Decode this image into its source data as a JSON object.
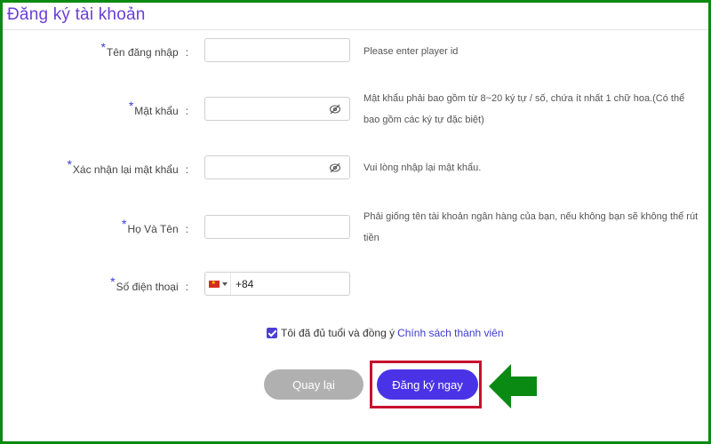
{
  "page": {
    "title": "Đăng ký tài khoản"
  },
  "form": {
    "required_mark": "*",
    "colon": ":",
    "username": {
      "label": "Tên đăng nhập",
      "value": "",
      "hint": "Please enter player id"
    },
    "password": {
      "label": "Mật khẩu",
      "value": "",
      "hint": "Mật khẩu phải bao gồm từ 8~20 ký tự / số, chứa ít nhất 1 chữ hoa.(Có thể bao gồm các ký tự đặc biệt)"
    },
    "confirm_password": {
      "label": "Xác nhận lại mật khẩu",
      "value": "",
      "hint": "Vui lòng nhập lại mật khẩu."
    },
    "full_name": {
      "label": "Họ Và Tên",
      "value": "",
      "hint": "Phải giống tên tài khoản ngân hàng của bạn, nếu không bạn sẽ không thể rút tiền"
    },
    "phone": {
      "label": "Số điện thoại",
      "country_code": "+84",
      "flag_icon": "vietnam-flag-icon"
    },
    "agree": {
      "text": "Tôi đã đủ tuổi và đồng ý",
      "link": "Chính sách thành viên",
      "checked": true
    }
  },
  "buttons": {
    "back": "Quay lại",
    "register": "Đăng ký ngay"
  },
  "colors": {
    "title": "#6a3fd6",
    "primary": "#4a33e6",
    "back_button": "#b0b0b0",
    "highlight_box": "#c8102e",
    "arrow": "#0a8a12",
    "frame": "#0a8a12"
  }
}
